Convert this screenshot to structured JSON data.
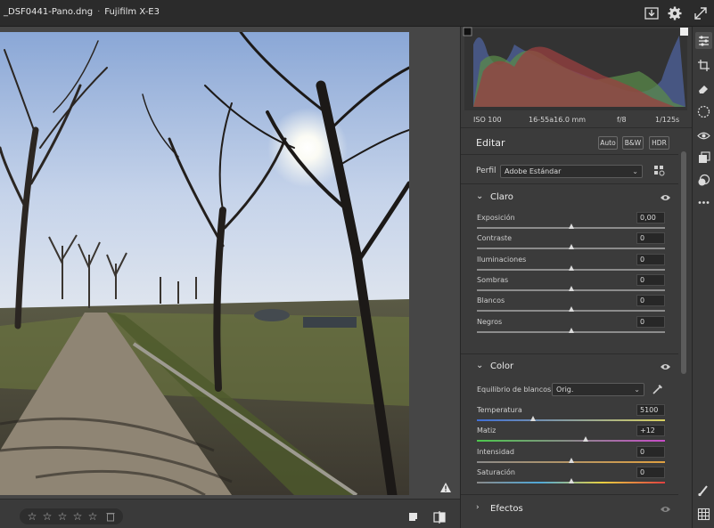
{
  "window": {
    "filename": "_DSF0441-Pano.dng",
    "camera": "Fujifilm X-E3"
  },
  "exif": {
    "iso": "ISO 100",
    "lens": "16-55a16.0 mm",
    "aperture": "f/8",
    "shutter": "1/125s"
  },
  "editar": {
    "label": "Editar",
    "auto_label": "Auto",
    "bw_label": "B&W",
    "hdr_label": "HDR"
  },
  "perfil": {
    "label": "Perfil",
    "value": "Adobe Estándar"
  },
  "claro": {
    "title": "Claro",
    "sliders": [
      {
        "name": "Exposición",
        "value": "0,00",
        "position": 0.5
      },
      {
        "name": "Contraste",
        "value": "0",
        "position": 0.5
      },
      {
        "name": "Iluminaciones",
        "value": "0",
        "position": 0.5
      },
      {
        "name": "Sombras",
        "value": "0",
        "position": 0.5
      },
      {
        "name": "Blancos",
        "value": "0",
        "position": 0.5
      },
      {
        "name": "Negros",
        "value": "0",
        "position": 0.5
      }
    ]
  },
  "color": {
    "title": "Color",
    "wb_label": "Equilibrio de blancos",
    "wb_value": "Orig.",
    "sliders": [
      {
        "name": "Temperatura",
        "value": "5100",
        "position": 0.3,
        "gradient": "linear-gradient(90deg,#3f6fd8,#d8d060)"
      },
      {
        "name": "Matiz",
        "value": "+12",
        "position": 0.58,
        "gradient": "linear-gradient(90deg,#4cc84c,#c84cc8)"
      },
      {
        "name": "Intensidad",
        "value": "0",
        "position": 0.5,
        "gradient": "linear-gradient(90deg,#8a8a8a,#e0a040)"
      },
      {
        "name": "Saturación",
        "value": "0",
        "position": 0.5,
        "gradient": "linear-gradient(90deg,#8a8a8a,#50a8d8,#e8d040,#e04040)"
      }
    ]
  },
  "efectos": {
    "title": "Efectos"
  },
  "rating": {
    "stars": [
      "☆",
      "☆",
      "☆",
      "☆",
      "☆"
    ]
  },
  "icons": {
    "export": "export-icon",
    "settings": "gear-icon",
    "fullscreen": "expand-icon"
  },
  "colors": {
    "panel_bg": "#3b3b3b",
    "titlebar_bg": "#2b2b2b",
    "text": "#d6d6d6"
  }
}
